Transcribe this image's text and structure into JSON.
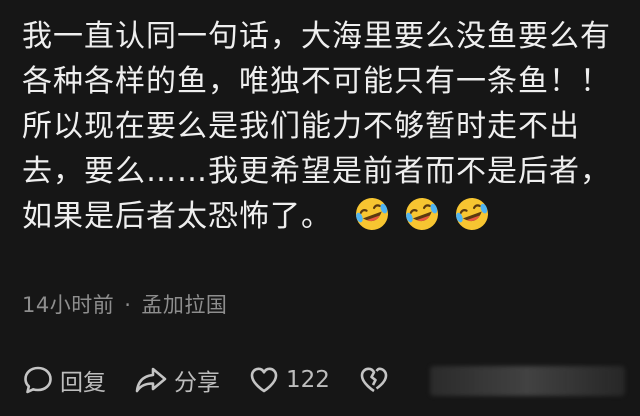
{
  "comment": {
    "lines": [
      "我一直认同一句话，大海里要么没鱼要么有",
      "各种各样的鱼，唯独不可能只有一条鱼！！",
      "所以现在要么是我们能力不够暂时走不出",
      "去，要么……我更希望是前者而不是后者，",
      "如果是后者太恐怖了。"
    ],
    "emojis": [
      "rolling-laughing-icon",
      "rolling-laughing-icon",
      "rolling-laughing-icon"
    ]
  },
  "meta": {
    "time": "14小时前",
    "separator": "·",
    "location": "孟加拉国"
  },
  "actions": {
    "reply_label": "回复",
    "share_label": "分享",
    "like_count": "122"
  },
  "colors": {
    "background": "#161616",
    "text": "#efefef",
    "meta": "#8e8e8e",
    "emoji_face": "#f7c531"
  }
}
